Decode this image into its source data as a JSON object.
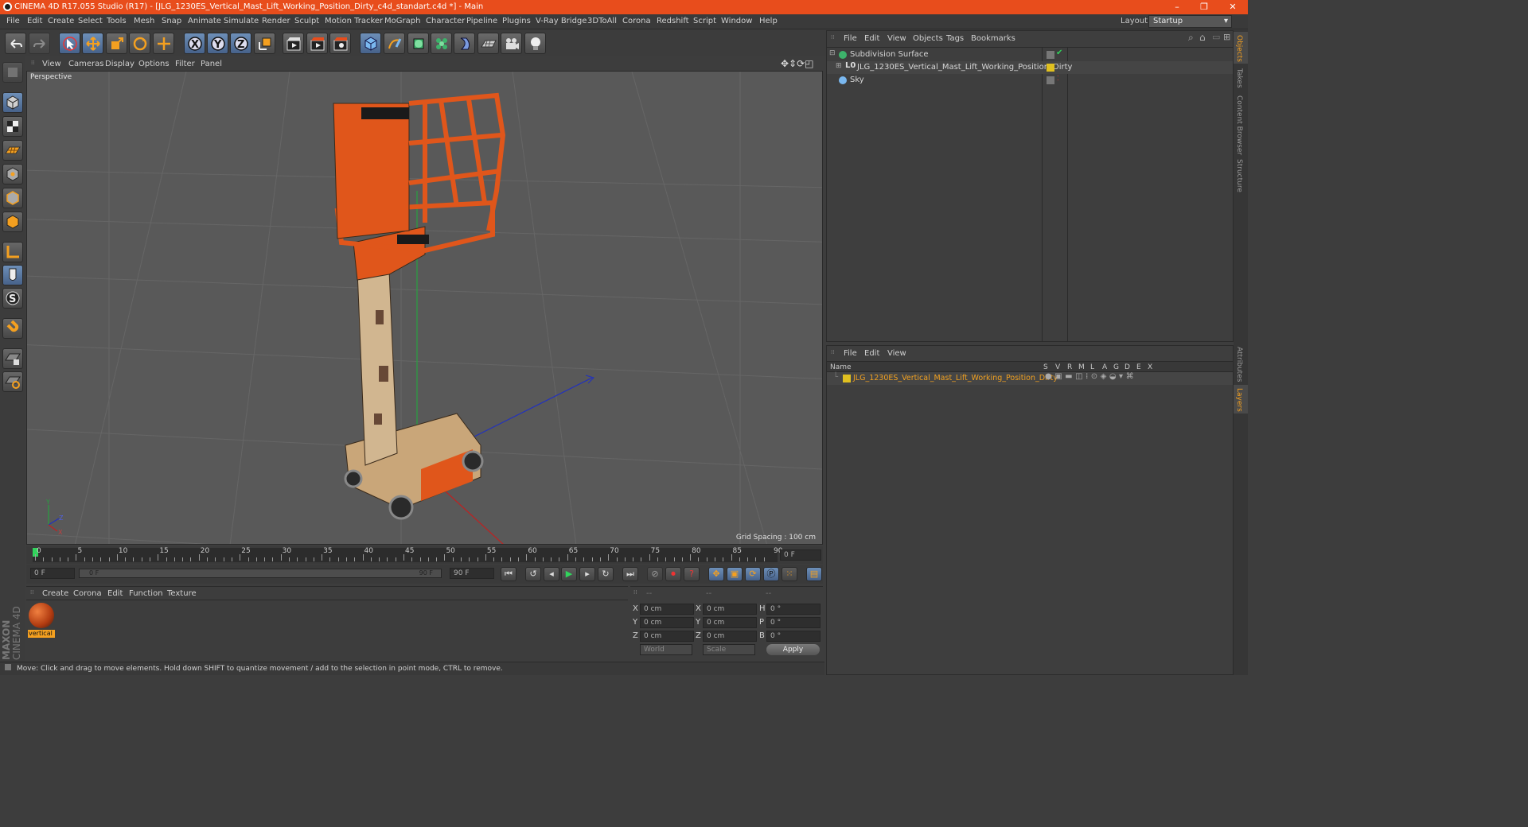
{
  "title": "CINEMA 4D R17.055 Studio (R17) - [JLG_1230ES_Vertical_Mast_Lift_Working_Position_Dirty_c4d_standart.c4d *] - Main",
  "window_buttons": [
    "–",
    "❐",
    "✕"
  ],
  "menu": [
    "File",
    "Edit",
    "Create",
    "Select",
    "Tools",
    "Mesh",
    "Snap",
    "Animate",
    "Simulate",
    "Render",
    "Sculpt",
    "Motion Tracker",
    "MoGraph",
    "Character",
    "Pipeline",
    "Plugins",
    "V-Ray Bridge",
    "3DToAll",
    "Corona",
    "Redshift",
    "Script",
    "Window",
    "Help"
  ],
  "layout": {
    "label": "Layout:",
    "value": "Startup"
  },
  "viewport": {
    "menu": [
      "View",
      "Cameras",
      "Display",
      "Options",
      "Filter",
      "Panel"
    ],
    "label": "Perspective",
    "grid_spacing": "Grid Spacing : 100 cm",
    "axis_labels": {
      "y": "Y",
      "z": "Z",
      "x": "X"
    }
  },
  "timeline": {
    "ticks": [
      "0",
      "5",
      "10",
      "15",
      "20",
      "25",
      "30",
      "35",
      "40",
      "45",
      "50",
      "55",
      "60",
      "65",
      "70",
      "75",
      "80",
      "85",
      "90"
    ],
    "current_frame": "0 F"
  },
  "transport": {
    "start": "0 F",
    "range_start": "0 F",
    "range_end": "90 F",
    "end": "90 F"
  },
  "material": {
    "menu": [
      "Create",
      "Corona",
      "Edit",
      "Function",
      "Texture"
    ],
    "items": [
      {
        "name": "vertical"
      }
    ]
  },
  "coordinates": {
    "headers": [
      "--",
      "--",
      "--"
    ],
    "rows": [
      {
        "a": "X",
        "av": "0 cm",
        "b": "X",
        "bv": "0 cm",
        "c": "H",
        "cv": "0 °"
      },
      {
        "a": "Y",
        "av": "0 cm",
        "b": "Y",
        "bv": "0 cm",
        "c": "P",
        "cv": "0 °"
      },
      {
        "a": "Z",
        "av": "0 cm",
        "b": "Z",
        "bv": "0 cm",
        "c": "B",
        "cv": "0 °"
      }
    ],
    "world": "World",
    "scale": "Scale",
    "apply": "Apply"
  },
  "status": "Move: Click and drag to move elements. Hold down SHIFT to quantize movement / add to the selection in point mode, CTRL to remove.",
  "brand": {
    "maxon": "MAXON",
    "c4d": "CINEMA 4D"
  },
  "object_manager": {
    "menu": [
      "File",
      "Edit",
      "View",
      "Objects",
      "Tags",
      "Bookmarks"
    ],
    "objects": [
      {
        "name": "Subdivision Surface",
        "indent": 0
      },
      {
        "name": "JLG_1230ES_Vertical_Mast_Lift_Working_Position_Dirty",
        "indent": 1
      },
      {
        "name": "Sky",
        "indent": 0
      }
    ]
  },
  "layer_manager": {
    "menu": [
      "File",
      "Edit",
      "View"
    ],
    "columns": {
      "name": "Name",
      "flags": [
        "S",
        "V",
        "R",
        "M",
        "L",
        "A",
        "G",
        "D",
        "E",
        "X"
      ]
    },
    "layers": [
      {
        "name": "JLG_1230ES_Vertical_Mast_Lift_Working_Position_Dirty",
        "color": "#e0c020"
      }
    ]
  },
  "side_tabs": [
    "Objects",
    "Takes",
    "Content Browser",
    "Structure"
  ],
  "side_tabs_lower": [
    "Attributes",
    "Layers"
  ],
  "colors": {
    "accent": "#e84d1c",
    "layer_text": "#f0a020",
    "object_text": "#d6d6d6"
  }
}
